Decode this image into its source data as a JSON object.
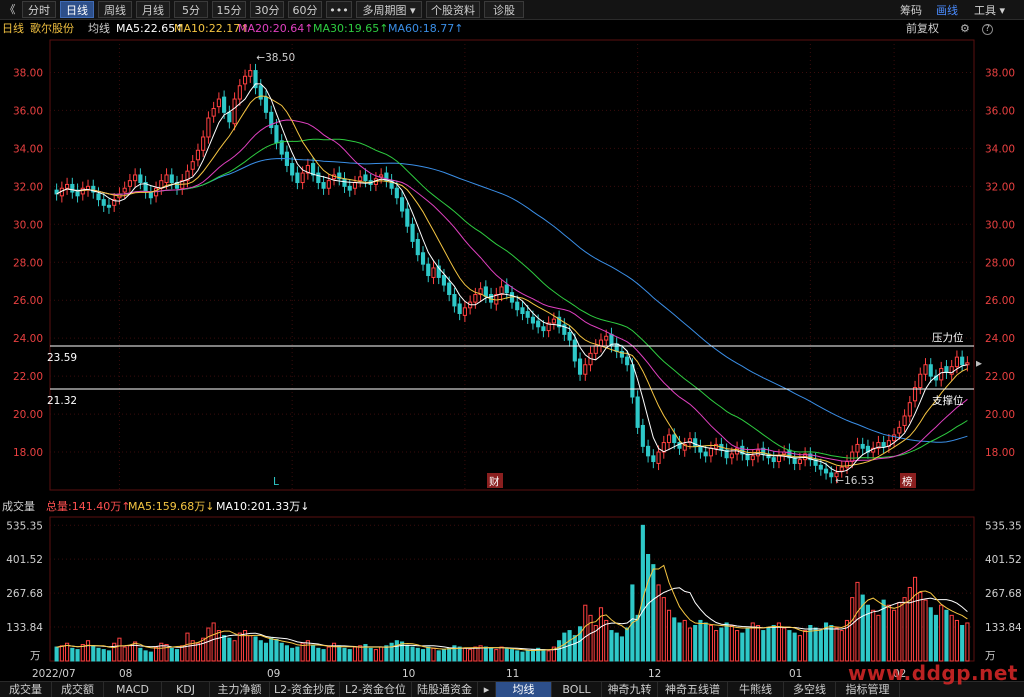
{
  "toolbar": {
    "back_icon": "double-chevron-left-icon",
    "back_glyph": "《",
    "tabs": [
      "分时",
      "日线",
      "周线",
      "月线",
      "5分",
      "15分",
      "30分",
      "60分",
      "•••",
      "多周期图 ▾",
      "个股资料",
      "诊股"
    ],
    "active_tab": "日线",
    "right": [
      "筹码",
      "画线",
      "工具 ▾"
    ],
    "right_active": "画线"
  },
  "info": {
    "period": "日线",
    "stock_name": "歌尔股份",
    "indicator": "均线",
    "ma": [
      {
        "label": "MA5:22.65↑",
        "color": "#ffffff"
      },
      {
        "label": "MA10:22.17↑",
        "color": "#f5c542"
      },
      {
        "label": "MA20:20.64↑",
        "color": "#e040c0"
      },
      {
        "label": "MA30:19.65↑",
        "color": "#2ecc40"
      },
      {
        "label": "MA60:18.77↑",
        "color": "#3a8ee6"
      }
    ],
    "fq": "前复权",
    "gear_icon": "settings-icon",
    "help_icon": "help-icon",
    "help_glyph": "?"
  },
  "price_axis": {
    "ticks": [
      "38.00",
      "36.00",
      "34.00",
      "32.00",
      "30.00",
      "28.00",
      "26.00",
      "24.00",
      "22.00",
      "20.00",
      "18.00"
    ]
  },
  "annotations": {
    "high": "←38.50",
    "low": "←16.53",
    "resistance_label": "压力位",
    "support_label": "支撑位",
    "resistance_value": "23.59",
    "support_value": "21.32",
    "marker_L": "L",
    "marker_cai": "财",
    "marker_bang": "榜"
  },
  "volume": {
    "title": "成交量",
    "total": "总量:141.40万↑",
    "ma5": "MA5:159.68万↓",
    "ma10": "MA10:201.33万↓",
    "ticks": [
      "535.35",
      "401.52",
      "267.68",
      "133.84"
    ],
    "unit": "万"
  },
  "xaxis": {
    "labels": [
      "2022/07",
      "08",
      "09",
      "10",
      "11",
      "12",
      "01",
      "02"
    ]
  },
  "bottom_tabs": [
    "成交量",
    "成交额",
    "MACD",
    "KDJ",
    "主力净额",
    "L2-资金抄底",
    "L2-资金仓位",
    "陆股通资金",
    "▸",
    "均线",
    "BOLL",
    "神奇九转",
    "神奇五线谱",
    "牛熊线",
    "多空线",
    "指标管理"
  ],
  "bottom_active": "均线",
  "watermark": "www.ddgp.net",
  "colors": {
    "up": "#ff4040",
    "down": "#2ec8c8",
    "ma5": "#ffffff",
    "ma10": "#f5c542",
    "ma20": "#e040c0",
    "ma30": "#2ecc40",
    "ma60": "#3a8ee6",
    "axis_text": "#e84040",
    "grid": "#3a0c0c"
  },
  "chart_data": [
    {
      "type": "candlestick",
      "title": "歌尔股份 日线",
      "ylim": [
        16.0,
        39.5
      ],
      "x_start": "2022/07",
      "x_end": "2023/02",
      "closes": [
        31.6,
        31.9,
        32.1,
        31.7,
        31.5,
        31.9,
        32.0,
        31.7,
        31.3,
        31.0,
        30.9,
        31.3,
        31.6,
        31.9,
        32.3,
        32.6,
        32.2,
        31.7,
        31.4,
        31.9,
        32.3,
        32.6,
        32.2,
        31.9,
        32.3,
        32.8,
        33.3,
        33.9,
        34.6,
        35.6,
        36.1,
        36.6,
        35.9,
        35.4,
        36.6,
        37.3,
        37.8,
        38.1,
        37.2,
        36.6,
        35.9,
        35.1,
        34.3,
        33.7,
        33.1,
        32.6,
        32.2,
        32.7,
        33.1,
        32.6,
        32.2,
        31.9,
        32.3,
        32.6,
        32.4,
        32.0,
        31.8,
        32.2,
        32.5,
        32.3,
        32.1,
        32.4,
        32.6,
        32.3,
        31.9,
        31.4,
        30.7,
        29.9,
        29.1,
        28.4,
        27.9,
        27.3,
        27.7,
        27.2,
        26.8,
        26.3,
        25.7,
        25.3,
        25.6,
        25.9,
        26.3,
        26.6,
        26.2,
        25.9,
        26.3,
        26.7,
        26.4,
        25.9,
        25.5,
        25.3,
        25.1,
        24.8,
        24.6,
        24.4,
        24.8,
        25.0,
        24.6,
        24.2,
        23.9,
        22.8,
        22.1,
        22.6,
        23.2,
        23.6,
        23.9,
        24.1,
        23.6,
        23.3,
        23.0,
        22.6,
        20.9,
        19.3,
        18.3,
        17.8,
        17.5,
        18.0,
        18.5,
        18.9,
        18.5,
        18.2,
        18.4,
        18.7,
        18.3,
        18.0,
        17.8,
        18.2,
        18.4,
        18.1,
        17.7,
        17.9,
        18.2,
        17.9,
        17.6,
        17.8,
        18.1,
        17.9,
        17.7,
        17.5,
        17.8,
        18.0,
        17.7,
        17.4,
        17.6,
        17.9,
        17.6,
        17.3,
        17.1,
        16.9,
        16.7,
        16.9,
        17.2,
        17.5,
        18.0,
        18.4,
        18.2,
        18.0,
        18.2,
        18.5,
        18.3,
        18.6,
        18.9,
        19.3,
        19.9,
        20.6,
        21.4,
        22.1,
        22.6,
        22.0,
        21.8,
        22.4,
        22.2,
        22.5,
        23.0,
        22.6,
        22.7
      ],
      "opens": [
        31.8,
        31.5,
        31.9,
        32.1,
        31.8,
        31.6,
        31.8,
        32.0,
        31.6,
        31.3,
        31.0,
        31.0,
        31.4,
        31.7,
        32.0,
        32.3,
        32.6,
        32.2,
        31.7,
        31.5,
        31.9,
        32.2,
        32.6,
        32.2,
        31.9,
        32.3,
        32.9,
        33.4,
        33.9,
        34.6,
        35.7,
        36.2,
        36.7,
        35.9,
        35.3,
        36.6,
        37.4,
        37.8,
        38.1,
        37.3,
        36.7,
        35.9,
        35.2,
        34.4,
        33.8,
        33.2,
        32.7,
        32.2,
        32.7,
        33.2,
        32.7,
        32.2,
        31.9,
        32.4,
        32.7,
        32.4,
        32.0,
        31.9,
        32.3,
        32.6,
        32.3,
        32.1,
        32.5,
        32.7,
        32.3,
        31.9,
        31.4,
        30.8,
        30.0,
        29.2,
        28.5,
        27.9,
        27.2,
        27.8,
        27.3,
        26.9,
        26.3,
        25.8,
        25.2,
        25.6,
        25.9,
        26.3,
        26.7,
        26.3,
        25.8,
        26.3,
        26.8,
        26.4,
        25.9,
        25.6,
        25.4,
        25.1,
        24.9,
        24.6,
        24.4,
        24.8,
        25.1,
        24.7,
        24.3,
        23.9,
        22.9,
        22.1,
        22.6,
        23.2,
        23.6,
        23.9,
        24.2,
        23.7,
        23.3,
        23.0,
        22.6,
        20.9,
        19.4,
        18.3,
        17.8,
        17.4,
        18.0,
        18.5,
        18.9,
        18.5,
        18.1,
        18.5,
        18.7,
        18.3,
        18.0,
        17.8,
        18.2,
        18.4,
        18.1,
        17.7,
        17.9,
        18.3,
        17.9,
        17.6,
        17.8,
        18.2,
        17.9,
        17.7,
        17.5,
        17.9,
        18.1,
        17.7,
        17.4,
        17.6,
        17.9,
        17.6,
        17.3,
        17.1,
        16.9,
        16.7,
        17.0,
        17.2,
        17.5,
        18.0,
        18.4,
        18.3,
        18.0,
        18.2,
        18.5,
        18.3,
        18.6,
        19.0,
        19.4,
        19.9,
        20.7,
        21.4,
        22.1,
        22.6,
        22.0,
        21.8,
        22.5,
        22.1,
        22.5,
        23.0,
        22.6
      ],
      "ma_lines": [
        "MA5",
        "MA10",
        "MA20",
        "MA30",
        "MA60"
      ],
      "horizontal_lines": [
        23.59,
        21.32
      ],
      "marked_high": 38.5,
      "marked_low": 16.53
    },
    {
      "type": "bar",
      "title": "成交量",
      "unit": "万",
      "ylim": [
        0,
        560
      ],
      "values": [
        55,
        60,
        70,
        50,
        45,
        65,
        80,
        60,
        50,
        45,
        40,
        70,
        90,
        55,
        60,
        75,
        50,
        40,
        35,
        55,
        70,
        65,
        50,
        45,
        60,
        110,
        80,
        70,
        90,
        130,
        150,
        120,
        100,
        90,
        80,
        110,
        120,
        100,
        95,
        80,
        70,
        90,
        85,
        70,
        60,
        50,
        55,
        70,
        80,
        60,
        50,
        45,
        55,
        70,
        60,
        50,
        45,
        55,
        60,
        65,
        50,
        45,
        55,
        60,
        70,
        80,
        75,
        60,
        55,
        50,
        45,
        55,
        50,
        40,
        45,
        50,
        60,
        55,
        50,
        45,
        55,
        60,
        55,
        50,
        45,
        55,
        50,
        45,
        40,
        35,
        40,
        45,
        50,
        45,
        40,
        55,
        80,
        110,
        120,
        100,
        135,
        220,
        180,
        140,
        210,
        160,
        120,
        110,
        95,
        130,
        300,
        180,
        535,
        420,
        380,
        300,
        250,
        200,
        170,
        150,
        160,
        130,
        140,
        160,
        150,
        140,
        120,
        130,
        150,
        140,
        120,
        110,
        130,
        150,
        140,
        120,
        130,
        140,
        150,
        130,
        120,
        110,
        100,
        120,
        140,
        130,
        120,
        150,
        140,
        130,
        120,
        160,
        250,
        310,
        260,
        220,
        200,
        180,
        240,
        220,
        200,
        230,
        250,
        290,
        330,
        270,
        240,
        210,
        180,
        220,
        200,
        180,
        160,
        140,
        150
      ],
      "ma5": 159.68,
      "ma10": 201.33,
      "total": 141.4
    }
  ]
}
